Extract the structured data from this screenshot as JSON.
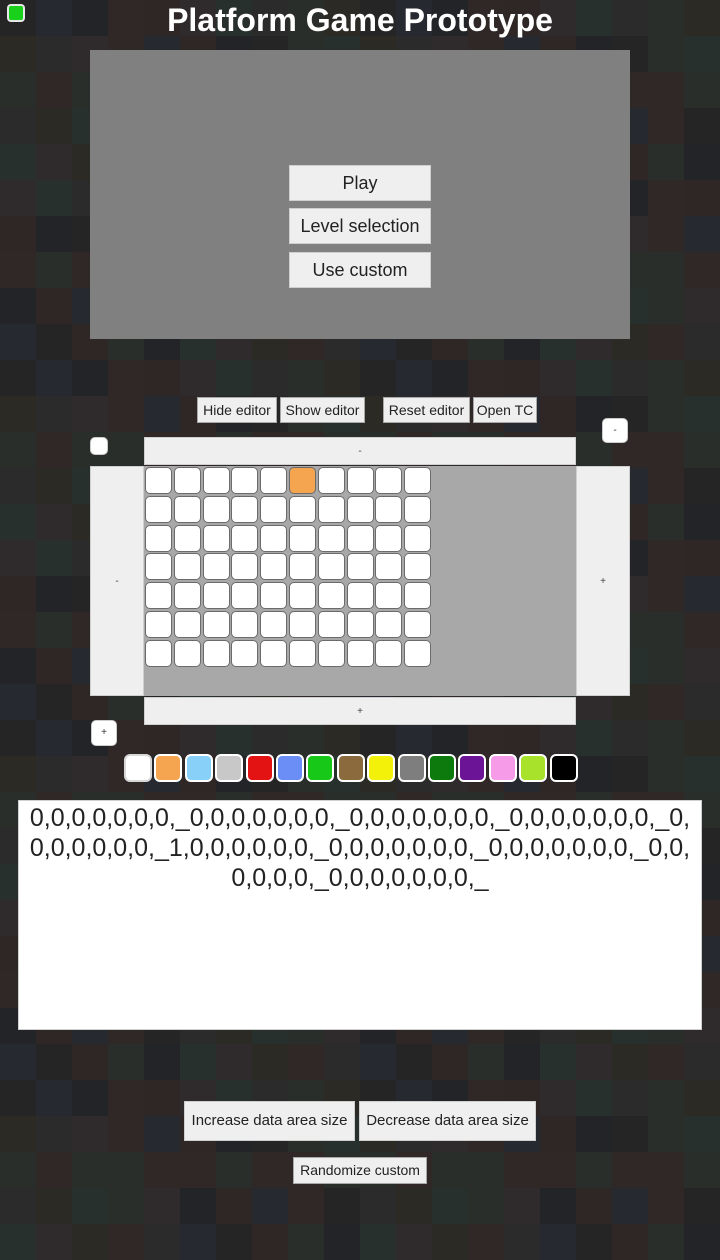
{
  "menu": {
    "title": "Platform Game Prototype",
    "buttons": [
      "Play",
      "Level selection",
      "Use custom"
    ]
  },
  "editor_controls": {
    "hide_editor": "Hide editor",
    "show_editor": "Show editor",
    "reset_editor": "Reset editor",
    "open_tc": "Open TC"
  },
  "edge_controls": {
    "top": "-",
    "bottom": "+",
    "left": "-",
    "right": "+",
    "corner_top_right": "-",
    "corner_bottom_left": "+",
    "corner_top_left": ""
  },
  "level_grid": {
    "columns": 10,
    "rows": 7,
    "cells": [
      [
        0,
        0,
        0,
        0,
        0,
        1,
        0,
        0,
        0,
        0
      ],
      [
        0,
        0,
        0,
        0,
        0,
        0,
        0,
        0,
        0,
        0
      ],
      [
        0,
        0,
        0,
        0,
        0,
        0,
        0,
        0,
        0,
        0
      ],
      [
        0,
        0,
        0,
        0,
        0,
        0,
        0,
        0,
        0,
        0
      ],
      [
        0,
        0,
        0,
        0,
        0,
        0,
        0,
        0,
        0,
        0
      ],
      [
        0,
        0,
        0,
        0,
        0,
        0,
        0,
        0,
        0,
        0
      ],
      [
        0,
        0,
        0,
        0,
        0,
        0,
        0,
        0,
        0,
        0
      ]
    ]
  },
  "palette": [
    "#ffffff",
    "#f5a54f",
    "#88d0f8",
    "#c8c8c8",
    "#e41313",
    "#6a8ef5",
    "#18c818",
    "#8b6b3d",
    "#f3f00a",
    "#7e7e7e",
    "#0c7a0c",
    "#6b1496",
    "#f69be8",
    "#a8e22a",
    "#000000"
  ],
  "data_area": {
    "text": "0,0,0,0,0,0,0,_0,0,0,0,0,0,0,_0,0,0,0,0,0,0,_0,0,0,0,0,0,0,_0,0,0,0,0,0,0,_1,0,0,0,0,0,0,_0,0,0,0,0,0,0,_0,0,0,0,0,0,0,_0,0,0,0,0,0,_0,0,0,0,0,0,0,_"
  },
  "bottom": {
    "increase": "Increase data area size",
    "decrease": "Decrease data area size",
    "randomize": "Randomize custom"
  },
  "colors": {
    "corner_indicator": "#19d11b",
    "selected_cell": "#f5a54f",
    "menu_panel": "#808080"
  }
}
